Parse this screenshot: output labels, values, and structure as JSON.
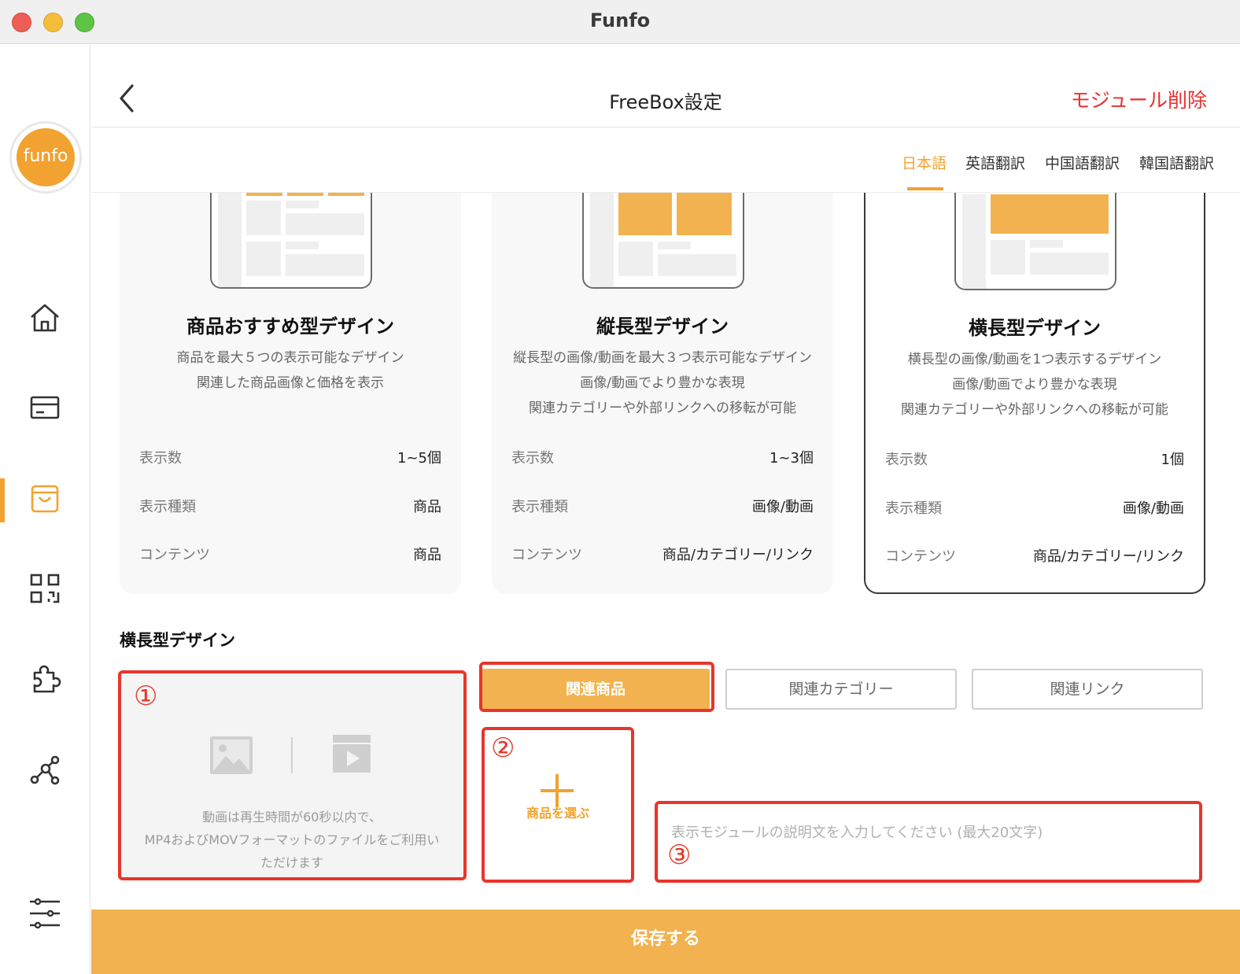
{
  "window": {
    "title": "Funfo"
  },
  "sidebar": {
    "logo_text": "funfo",
    "items": [
      {
        "icon": "home-icon"
      },
      {
        "icon": "card-icon"
      },
      {
        "icon": "shopping-bag-icon",
        "active": true
      },
      {
        "icon": "qr-code-icon"
      },
      {
        "icon": "puzzle-icon"
      },
      {
        "icon": "share-nodes-icon"
      },
      {
        "icon": "sliders-icon"
      }
    ]
  },
  "header": {
    "title": "FreeBox設定",
    "delete_label": "モジュール削除"
  },
  "language_tabs": [
    {
      "label": "日本語",
      "active": true
    },
    {
      "label": "英語翻訳"
    },
    {
      "label": "中国語翻訳"
    },
    {
      "label": "韓国語翻訳"
    }
  ],
  "design_cards": [
    {
      "title": "商品おすすめ型デザイン",
      "desc": [
        "商品を最大５つの表示可能なデザイン",
        "関連した商品画像と価格を表示"
      ],
      "specs": [
        {
          "label": "表示数",
          "value": "1~5個"
        },
        {
          "label": "表示種類",
          "value": "商品"
        },
        {
          "label": "コンテンツ",
          "value": "商品"
        }
      ]
    },
    {
      "title": "縦長型デザイン",
      "desc": [
        "縦長型の画像/動画を最大３つ表示可能なデザイン",
        "画像/動画でより豊かな表現",
        "関連カテゴリーや外部リンクへの移転が可能"
      ],
      "specs": [
        {
          "label": "表示数",
          "value": "1~3個"
        },
        {
          "label": "表示種類",
          "value": "画像/動画"
        },
        {
          "label": "コンテンツ",
          "value": "商品/カテゴリー/リンク"
        }
      ]
    },
    {
      "title": "横長型デザイン",
      "selected": true,
      "desc": [
        "横長型の画像/動画を1つ表示するデザイン",
        "画像/動画でより豊かな表現",
        "関連カテゴリーや外部リンクへの移転が可能"
      ],
      "specs": [
        {
          "label": "表示数",
          "value": "1個"
        },
        {
          "label": "表示種類",
          "value": "画像/動画"
        },
        {
          "label": "コンテンツ",
          "value": "商品/カテゴリー/リンク"
        }
      ]
    }
  ],
  "editor": {
    "section_title": "横長型デザイン",
    "media_hint": [
      "動画は再生時間が60秒以内で、",
      "MP4およびMOVフォーマットのファイルをご利用い",
      "ただけます"
    ],
    "link_tabs": [
      {
        "label": "関連商品",
        "active": true
      },
      {
        "label": "関連カテゴリー"
      },
      {
        "label": "関連リンク"
      }
    ],
    "pick_product_label": "商品を選ぶ",
    "description_placeholder": "表示モジュールの説明文を入力してください (最大20文字)",
    "description_value": ""
  },
  "annotations": [
    "①",
    "②",
    "③"
  ],
  "save_label": "保存する",
  "colors": {
    "accent": "#f2a230",
    "accent_light": "#f2b24f",
    "danger": "#e63030",
    "annotation": "#e8352b"
  }
}
